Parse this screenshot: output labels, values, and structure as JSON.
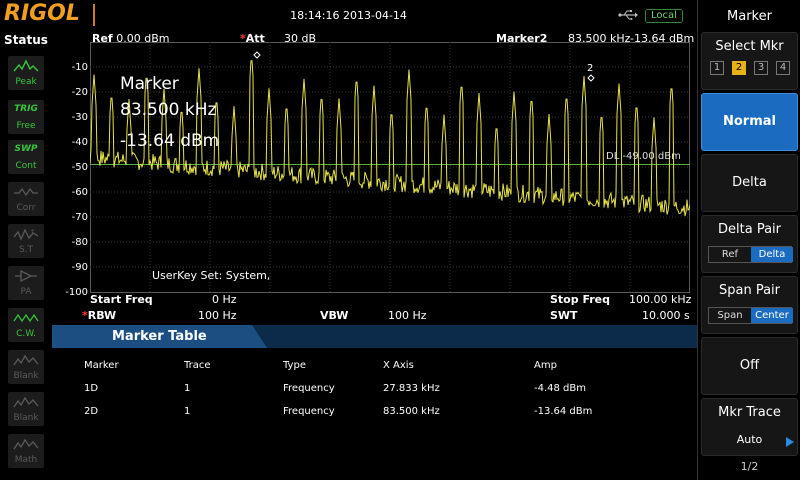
{
  "top": {
    "logo": "RIGOL",
    "time": "18:14:16 2013-04-14",
    "local": "Local"
  },
  "status": {
    "title": "Status",
    "items": [
      {
        "label": "Peak",
        "icon": "peak-icon"
      },
      {
        "top": "TRIG",
        "label": "Free"
      },
      {
        "top": "SWP",
        "label": "Cont"
      },
      {
        "label": "Corr",
        "icon": "corr-icon"
      },
      {
        "label": "S.T",
        "icon": "st-icon"
      },
      {
        "label": "PA",
        "icon": "pa-icon"
      },
      {
        "label": "C.W.",
        "icon": "cw-icon"
      },
      {
        "label": "Blank",
        "icon": "trace-blank-icon"
      },
      {
        "label": "Blank",
        "icon": "trace-blank-icon"
      },
      {
        "label": "Math",
        "icon": "math-icon"
      }
    ]
  },
  "plot": {
    "ref_label": "Ref",
    "ref_value": "0.00 dBm",
    "att_label": "Att",
    "att_value": "30 dB",
    "marker_label": "Marker2",
    "marker_freq": "83.500 kHz",
    "marker_amp": "-13.64 dBm",
    "big_marker": {
      "title": "Marker",
      "freq": "83.500 kHz",
      "amp": "-13.64 dBm"
    },
    "dl_label": "DL -49.00 dBm",
    "userkey": "UserKey Set:   System,",
    "y_ticks": [
      "-10",
      "-20",
      "-30",
      "-40",
      "-50",
      "-60",
      "-70",
      "-80",
      "-90",
      "-100"
    ],
    "start_freq_label": "Start Freq",
    "start_freq": "0 Hz",
    "stop_freq_label": "Stop Freq",
    "stop_freq": "100.00 kHz",
    "rbw_label": "RBW",
    "rbw": "100 Hz",
    "vbw_label": "VBW",
    "vbw": "100 Hz",
    "swt_label": "SWT",
    "swt": "10.000 s",
    "marker2_tag": "2",
    "colors": {
      "trace": "#e6e24a",
      "display_line": "#58b53a",
      "grid": "#3a3a3a"
    }
  },
  "table": {
    "title": "Marker Table",
    "headers": [
      "Marker",
      "Trace",
      "Type",
      "X Axis",
      "Amp"
    ],
    "rows": [
      [
        "1D",
        "1",
        "Frequency",
        "27.833 kHz",
        "-4.48 dBm"
      ],
      [
        "2D",
        "1",
        "Frequency",
        "83.500 kHz",
        "-13.64 dBm"
      ]
    ]
  },
  "menu": {
    "title": "Marker",
    "select_mkr": "Select Mkr",
    "mkr_nums": [
      "1",
      "2",
      "3",
      "4"
    ],
    "normal": "Normal",
    "delta": "Delta",
    "delta_pair": "Delta Pair",
    "delta_pair_opts": [
      "Ref",
      "Delta"
    ],
    "span_pair": "Span Pair",
    "span_pair_opts": [
      "Span",
      "Center"
    ],
    "off": "Off",
    "mkr_trace": "Mkr Trace",
    "mkr_trace_value": "Auto",
    "page": "1/2"
  }
}
